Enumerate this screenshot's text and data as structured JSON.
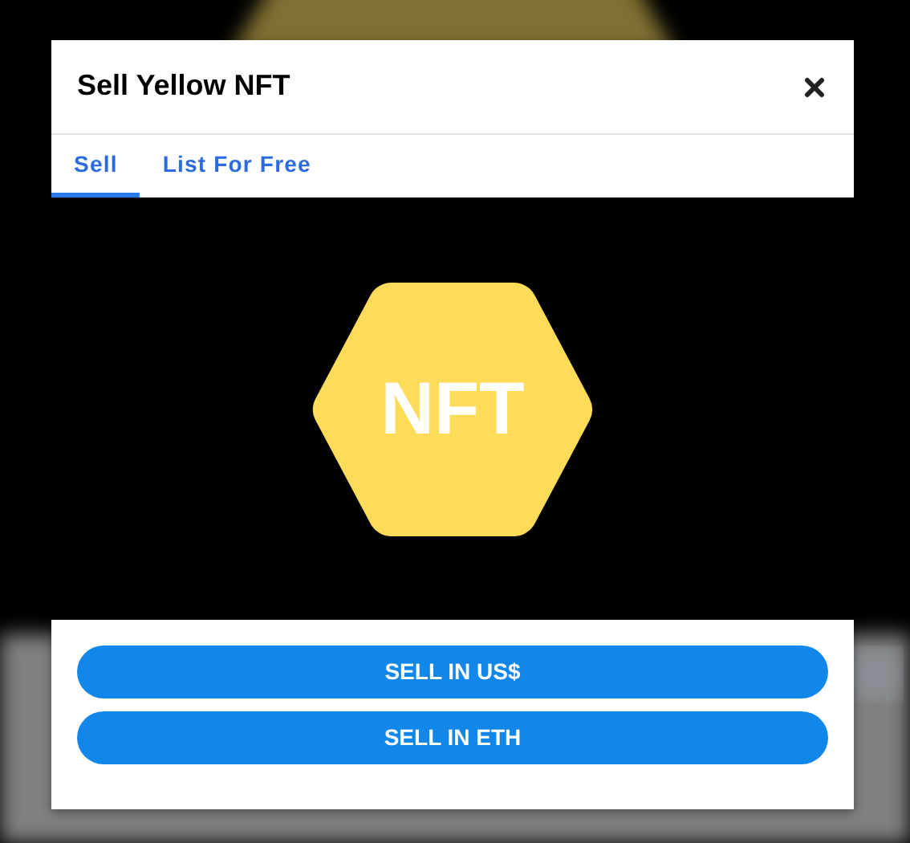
{
  "modal": {
    "title": "Sell Yellow NFT",
    "tabs": [
      {
        "label": "Sell",
        "selected": true
      },
      {
        "label": "List For Free",
        "selected": false
      }
    ],
    "preview": {
      "badge_text": "NFT"
    },
    "buttons": [
      "SELL IN US$",
      "SELL IN ETH"
    ]
  }
}
